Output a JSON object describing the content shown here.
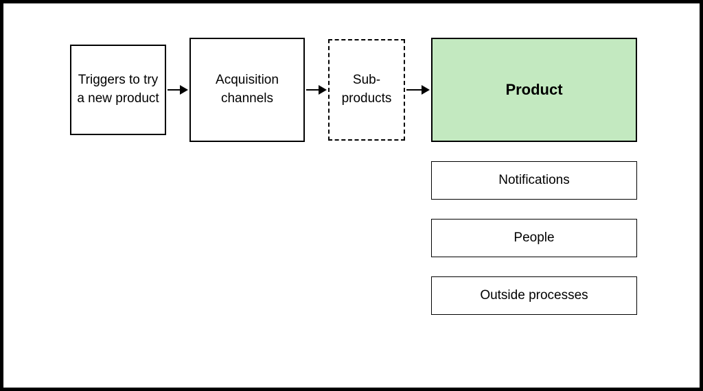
{
  "diagram": {
    "boxes": {
      "triggers": "Triggers to try a new product",
      "acquisition": "Acquisition channels",
      "subproducts": "Sub-products",
      "product": "Product",
      "notifications": "Notifications",
      "people": "People",
      "outside": "Outside processes"
    },
    "highlight_color": "#c3e9c0",
    "flow": [
      "triggers",
      "acquisition",
      "subproducts",
      "product"
    ],
    "stack_below_product": [
      "notifications",
      "people",
      "outside"
    ]
  }
}
